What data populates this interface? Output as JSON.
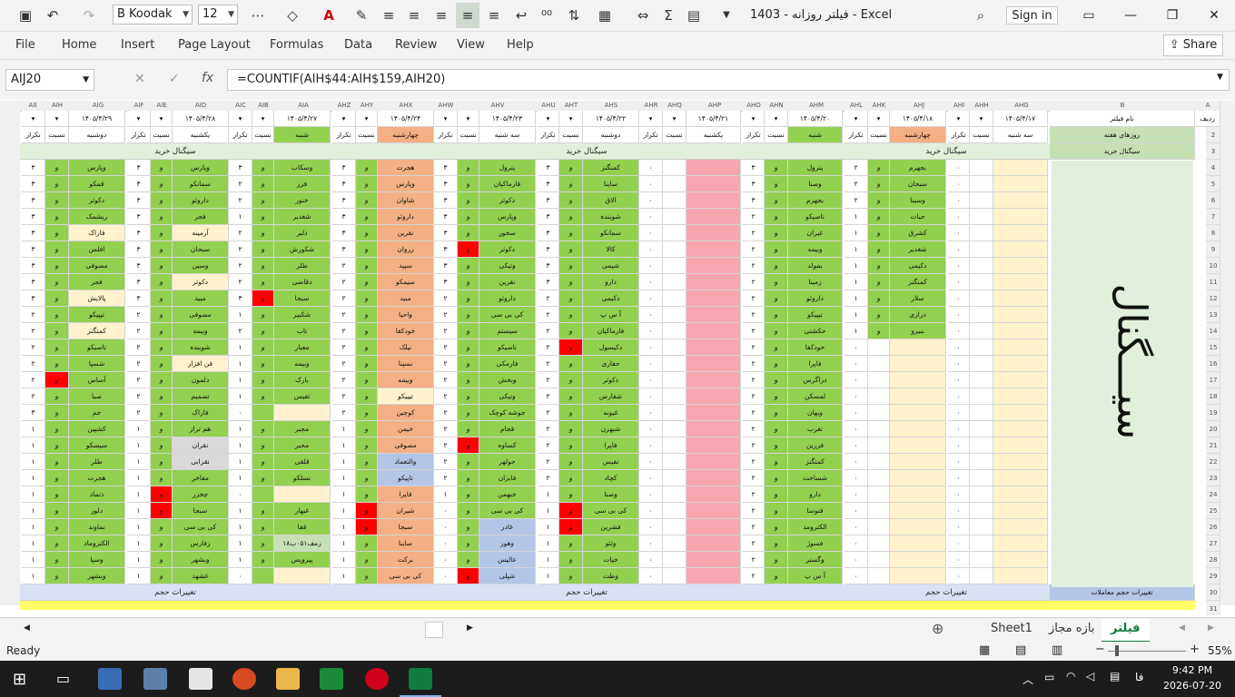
{
  "titlebar": {
    "font_name": "B Koodak",
    "font_size": "12",
    "doc_title": "فیلتر روزانه - 1403  -  Excel",
    "signin_label": "Sign in"
  },
  "menu": {
    "items": [
      "File",
      "Home",
      "Insert",
      "Page Layout",
      "Formulas",
      "Data",
      "Review",
      "View",
      "Help"
    ],
    "share_label": "Share"
  },
  "formula_bar": {
    "name_box": "AIJ20",
    "formula": "=COUNTIF(AIH$44:AIH$159,AIH20)"
  },
  "columns": [
    "AII",
    "AIH",
    "AIG",
    "AIF",
    "AIE",
    "AID",
    "AIC",
    "AIB",
    "AIA",
    "AHZ",
    "AHY",
    "AHX",
    "AHW",
    "AHV",
    "AHU",
    "AHT",
    "AHS",
    "AHR",
    "AHQ",
    "AHP",
    "AHO",
    "AHN",
    "AHM",
    "AHL",
    "AHK",
    "AHJ",
    "AHI",
    "AHH",
    "AHG",
    "B",
    "A"
  ],
  "rows": [
    "1",
    "2",
    "3",
    "4",
    "5",
    "6",
    "7",
    "8",
    "9",
    "10",
    "11",
    "12",
    "13",
    "14",
    "15",
    "16",
    "17",
    "18",
    "19",
    "20",
    "21",
    "22",
    "23",
    "24",
    "25",
    "26",
    "27",
    "28",
    "29",
    "30",
    "31"
  ],
  "header_labels": {
    "radif": "ردیف",
    "filter_name": "نام فیلتر",
    "weekdays": "روزهای هفته",
    "buy_signal": "سیگنال خرید",
    "volume_changes": "تغییرات حجم",
    "volume_changes_trades": "تغییرات حجم معاملات",
    "big_signal": "سیـــگنال",
    "ratio": "نسبت",
    "repeat": "تکرار"
  },
  "days": [
    {
      "date": "۱۴۰۵/۴/۲۹",
      "name": "دوشنبه"
    },
    {
      "date": "۱۴۰۵/۴/۲۸",
      "name": "یکشنبه"
    },
    {
      "date": "۱۴۰۵/۴/۲۷",
      "name": "شنبه"
    },
    {
      "date": "۱۴۰۵/۴/۲۴",
      "name": "چهارشنبه"
    },
    {
      "date": "۱۴۰۵/۴/۲۳",
      "name": "سه شنبه"
    },
    {
      "date": "۱۴۰۵/۴/۲۲",
      "name": "دوشنبه"
    },
    {
      "date": "۱۴۰۵/۴/۲۱",
      "name": "یکشنبه"
    },
    {
      "date": "۱۴۰۵/۴/۲۰",
      "name": "شنبه"
    },
    {
      "date": "۱۴۰۵/۴/۱۸",
      "name": "چهارشنبه"
    },
    {
      "date": "۱۴۰۵/۴/۱۷",
      "name": "سه شنبه"
    }
  ],
  "day_groups": [
    {
      "names": [
        "وپارس",
        "قمکو",
        "دکوثر",
        "ریشمک",
        "فاراک",
        "افلس",
        "مصوفی",
        "فجر",
        "پالایش",
        "تیپیکو",
        "کمنگنز",
        "تاصیکو",
        "شسپا",
        "آساس",
        "صبا",
        "جم",
        "کشپین",
        "سیسکو",
        "طلر",
        "هجرت",
        "دتماد",
        "دلور",
        "نماوند",
        "الکتروماد",
        "وسپا",
        "وبشهر"
      ],
      "repeat": [
        "۳",
        "۳",
        "۳",
        "۳",
        "۳",
        "۳",
        "۳",
        "۳",
        "۳",
        "۲",
        "۲",
        "۲",
        "۲",
        "۲",
        "۲",
        "۳",
        "۱",
        "۱",
        "۱",
        "۱",
        "۱",
        "۱",
        "۱",
        "۱",
        "۱",
        "۱"
      ]
    },
    {
      "names": [
        "وپارس",
        "سمانکو",
        "داروئو",
        "فجر",
        "آرمینه",
        "سبحان",
        "وسین",
        "دکوثر",
        "مبید",
        "مصوفی",
        "وبیمه",
        "شوینده",
        "فن افزار",
        "دلمون",
        "تصمیم",
        "فاراک",
        "هم تراز",
        "نقران",
        "نقرابی",
        "مفاخر",
        "چخزر",
        "سبجا",
        "کی بی سی",
        "زفارس",
        "وبشهر",
        "غشهد"
      ],
      "repeat": [
        "۳",
        "۳",
        "۳",
        "۳",
        "۳",
        "۳",
        "۳",
        "۳",
        "۳",
        "۲",
        "۲",
        "۲",
        "۲",
        "۲",
        "۲",
        "۲",
        "۱",
        "۱",
        "۱",
        "۱",
        "۱",
        "۱",
        "۱",
        "۱",
        "۱",
        "۱"
      ]
    },
    {
      "names": [
        "وسکاب",
        "فزر",
        "خنور",
        "شغدیر",
        "دلبر",
        "شکورش",
        "طلر",
        "دقاضی",
        "سبجا",
        "شکبیر",
        "تاب",
        "معیار",
        "وبیمه",
        "بارک",
        "تفیس",
        "",
        "مجبر",
        "محبر",
        "قلقی",
        "نسلکو",
        "",
        "غبهار",
        "قفا",
        "زمف۰۵۱ب۱۸",
        "پیروپس",
        ""
      ],
      "repeat": [
        "۳",
        "۲",
        "۲",
        "۱",
        "۲",
        "۲",
        "۲",
        "۲",
        "۳",
        "۱",
        "۲",
        "۱",
        "۱",
        "۱",
        "۱",
        "۰",
        "۱",
        "۱",
        "۱",
        "۱",
        "۰",
        "۱",
        "۱",
        "۱",
        "۱",
        "۰"
      ]
    },
    {
      "names": [
        "هجرت",
        "وپارس",
        "شاوان",
        "داروئو",
        "نقرین",
        "زروان",
        "سپید",
        "سیمکو",
        "مبید",
        "واحیا",
        "خودکفا",
        "نیلک",
        "نسپنا",
        "وبیمه",
        "تیپیکو",
        "کوچین",
        "خیمن",
        "مصوفی",
        "والتعماد",
        "تاپیکو",
        "قاپرا",
        "شیران",
        "سبجا",
        "ساینا",
        "برکت",
        "کی بی سی"
      ],
      "repeat": [
        "۳",
        "۳",
        "۳",
        "۳",
        "۳",
        "۳",
        "۲",
        "۲",
        "۲",
        "۲",
        "۲",
        "۲",
        "۲",
        "۲",
        "۲",
        "۲",
        "۱",
        "۱",
        "۱",
        "۱",
        "۱",
        "۱",
        "۱",
        "۱",
        "۱",
        "۱"
      ]
    },
    {
      "names": [
        "پترول",
        "فارماکیان",
        "دکوثر",
        "وپارس",
        "سخور",
        "دکوثر",
        "وتیکی",
        "نقرین",
        "داروئو",
        "کی بی سی",
        "سیستم",
        "تاصیکو",
        "فارمکی",
        "وبخش",
        "وتیکی",
        "جوشه کوچک",
        "قجام",
        "کساوه",
        "جولهر",
        "فابزان",
        "خبهمن",
        "کی بی سی",
        "غادر",
        "وهور",
        "عالیس",
        "شپلی"
      ],
      "repeat": [
        "۳",
        "۳",
        "۳",
        "۳",
        "۳",
        "۳",
        "۳",
        "۳",
        "۲",
        "۲",
        "۲",
        "۲",
        "۲",
        "۲",
        "۲",
        "۲",
        "۲",
        "۲",
        "۲",
        "۲",
        "۱",
        "۰",
        "۰",
        "۰",
        "۰",
        "۰"
      ]
    },
    {
      "names": [
        "کمنگنز",
        "ساینا",
        "الاق",
        "شوینده",
        "سمانکو",
        "کالا",
        "شیمی",
        "دارو",
        "دکیمی",
        "آ س پ",
        "فارماکیان",
        "دکیسول",
        "حفاری",
        "دکوثر",
        "شفارس",
        "غیونه",
        "شبهرن",
        "فاپرا",
        "نفیس",
        "کچاد",
        "وصنا",
        "کی بی سی",
        "فشرین",
        "وثئو",
        "خیات",
        "وطت"
      ],
      "repeat": [
        "۳",
        "۳",
        "۳",
        "۳",
        "۳",
        "۳",
        "۳",
        "۳",
        "۲",
        "۲",
        "۲",
        "۲",
        "۲",
        "۲",
        "۲",
        "۲",
        "۲",
        "۲",
        "۲",
        "۲",
        "۱",
        "۱",
        "۱",
        "۱",
        "۱",
        "۱"
      ]
    },
    {
      "names": [],
      "repeat": [
        "۰",
        "۰",
        "۰",
        "۰",
        "۰",
        "۰",
        "۰",
        "۰",
        "۰",
        "۰",
        "۰",
        "۰",
        "۰",
        "۰",
        "۰",
        "۰",
        "۰",
        "۰",
        "۰",
        "۰",
        "۰",
        "۰",
        "۰",
        "۰",
        "۰",
        "۰"
      ]
    },
    {
      "names": [
        "پترول",
        "وصنا",
        "بجهرم",
        "تاصیکو",
        "غیران",
        "وبیمه",
        "بمولد",
        "زمینا",
        "داروئو",
        "تیپیکو",
        "حکشتی",
        "خودکفا",
        "فاپرا",
        "دراگرس",
        "لمسکن",
        "وبهان",
        "تغرب",
        "فزرین",
        "کمنگنز",
        "شساخت",
        "دارو",
        "فتوسا",
        "الکترومد",
        "فسوژ",
        "وگستر",
        "آ س پ"
      ],
      "repeat": [
        "۳",
        "۳",
        "۳",
        "۲",
        "۲",
        "۲",
        "۲",
        "۲",
        "۲",
        "۲",
        "۲",
        "۲",
        "۲",
        "۲",
        "۲",
        "۲",
        "۲",
        "۲",
        "۲",
        "۲",
        "۲",
        "۲",
        "۲",
        "۲",
        "۲",
        "۲"
      ]
    },
    {
      "names": [
        "بجهرم",
        "سبحان",
        "وسینا",
        "حیات",
        "کشرق",
        "شغدیر",
        "دکیمی",
        "کمنگنز",
        "سلار",
        "درازی",
        "بنیرو",
        "",
        "",
        "",
        "",
        "",
        "",
        "",
        "",
        "",
        "",
        "",
        "",
        "",
        "",
        ""
      ],
      "repeat": [
        "۲",
        "۲",
        "۲",
        "۱",
        "۱",
        "۱",
        "۱",
        "۱",
        "۱",
        "۱",
        "۱",
        "۰",
        "۰",
        "۰",
        "۰",
        "۰",
        "۰",
        "۰",
        "۰",
        "۰",
        "۰",
        "۰",
        "۰",
        "۰",
        "۰",
        "۰"
      ]
    },
    {
      "names": [],
      "repeat": [
        "۰",
        "۰",
        "۰",
        "۰",
        "۰",
        "۰",
        "۰",
        "۰",
        "۰",
        "۰",
        "۰",
        "۰",
        "۰",
        "۰",
        "۰",
        "۰",
        "۰",
        "۰",
        "۰",
        "۰",
        "۰",
        "۰",
        "۰",
        "۰",
        "۰",
        "۰"
      ]
    }
  ],
  "sheet_tabs": [
    "Sheet1",
    "بازه مجاز",
    "فیلتر"
  ],
  "status": {
    "ready": "Ready",
    "zoom": "55%"
  },
  "taskbar": {
    "time": "9:42 PM",
    "date": "2026-07-20",
    "lang": "فا"
  },
  "colors": {
    "green": "#92d050",
    "yellow": "#fff2cc",
    "blue": "#b4c6e7",
    "red": "#ff0000",
    "pink": "#f8a5b0",
    "excel_green": "#107c41"
  }
}
